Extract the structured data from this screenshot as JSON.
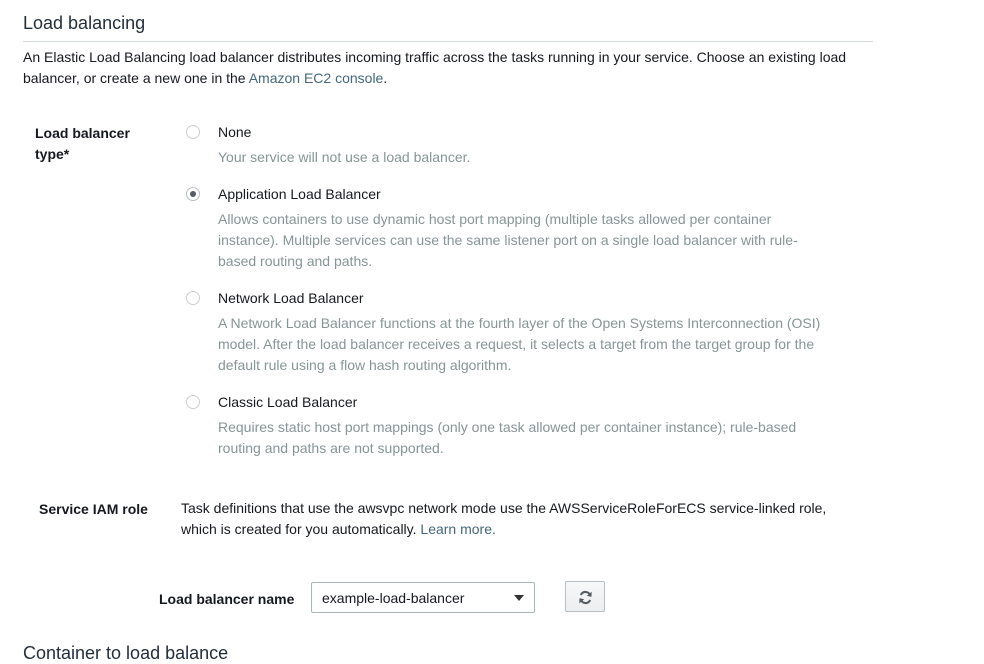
{
  "section": {
    "title": "Load balancing",
    "intro_text": "An Elastic Load Balancing load balancer distributes incoming traffic across the tasks running in your service. Choose an existing load balancer, or create a new one in the ",
    "intro_link": "Amazon EC2 console",
    "intro_end": "."
  },
  "lb_type": {
    "label": "Load balancer type*",
    "options": [
      {
        "label": "None",
        "description": "Your service will not use a load balancer.",
        "selected": false
      },
      {
        "label": "Application Load Balancer",
        "description": "Allows containers to use dynamic host port mapping (multiple tasks allowed per container instance). Multiple services can use the same listener port on a single load balancer with rule-based routing and paths.",
        "selected": true
      },
      {
        "label": "Network Load Balancer",
        "description": "A Network Load Balancer functions at the fourth layer of the Open Systems Interconnection (OSI) model. After the load balancer receives a request, it selects a target from the target group for the default rule using a flow hash routing algorithm.",
        "selected": false
      },
      {
        "label": "Classic Load Balancer",
        "description": "Requires static host port mappings (only one task allowed per container instance); rule-based routing and paths are not supported.",
        "selected": false
      }
    ]
  },
  "iam": {
    "label": "Service IAM role",
    "text": "Task definitions that use the awsvpc network mode use the AWSServiceRoleForECS service-linked role, which is created for you automatically. ",
    "link": "Learn more."
  },
  "lb_name": {
    "label": "Load balancer name",
    "value": "example-load-balancer"
  },
  "refresh_icon": "refresh-icon",
  "next_section": {
    "title": "Container to load balance"
  },
  "colors": {
    "link": "#44687d",
    "description": "#879596",
    "divider": "#d5dbdb"
  }
}
